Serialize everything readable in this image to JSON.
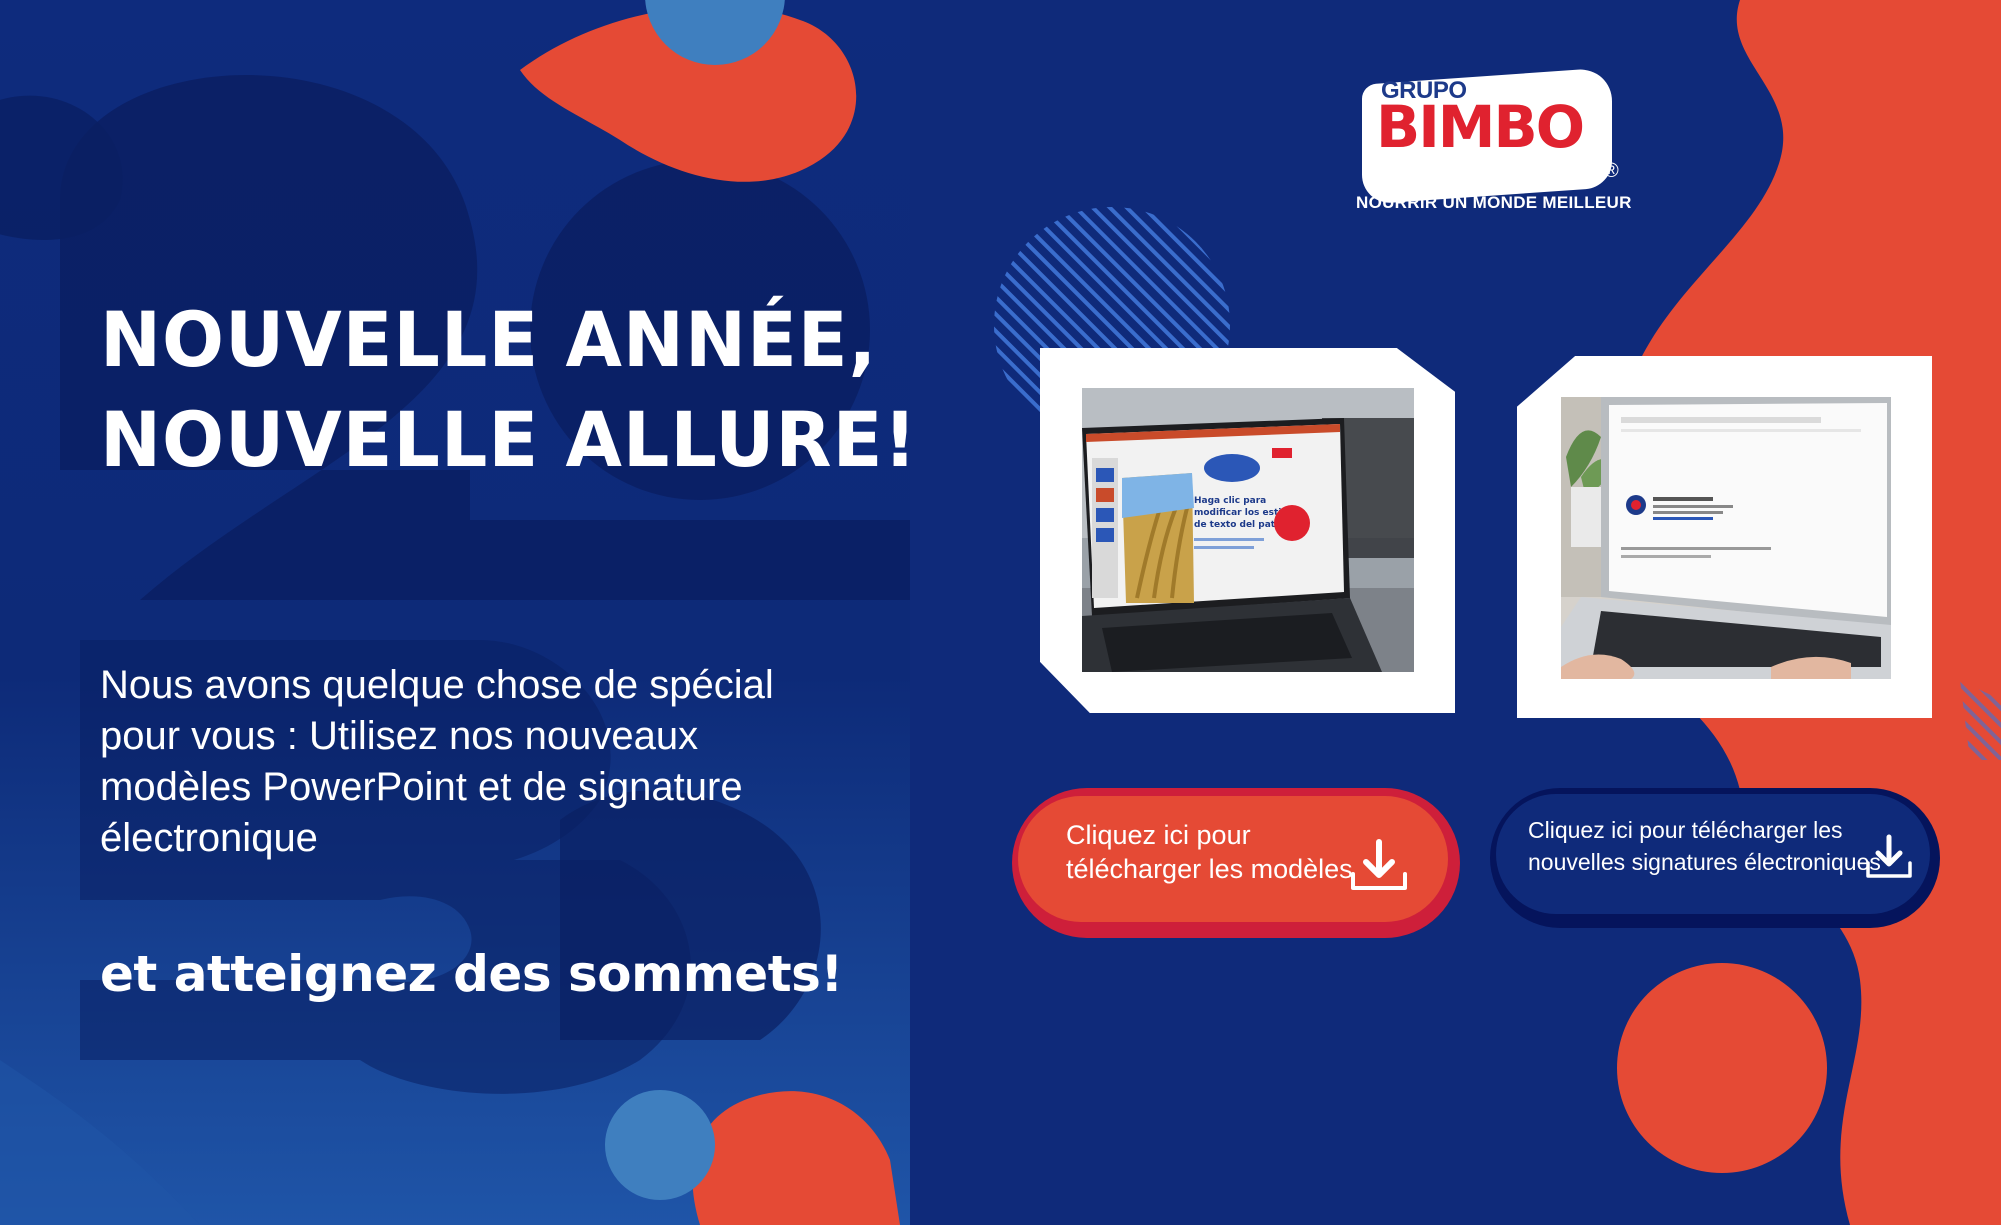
{
  "headline": {
    "line1": "NOUVELLE ANNÉE,",
    "line2": "NOUVELLE ALLURE!"
  },
  "body": {
    "text": "Nous avons quelque chose de spécial pour vous : Utilisez nos nouveaux modèles PowerPoint et de signature électronique"
  },
  "tagline": "et atteignez des sommets!",
  "logo": {
    "grupo": "GRUPO",
    "brand": "BIMBO",
    "registered": "®",
    "slogan": "NOURRIR UN MONDE MEILLEUR"
  },
  "ppt_slide": {
    "title": "Haga clic para modificar los estilos de texto del patrón"
  },
  "cta": {
    "models_label": "Cliquez ici pour télécharger les modèles",
    "signatures_label": "Cliquez ici pour télécharger les nouvelles signatures électroniques"
  },
  "icons": {
    "download": "download-icon"
  },
  "colors": {
    "navy": "#0f2a7a",
    "deep_navy": "#08195c",
    "coral": "#e54a35",
    "sky_blue": "#3f7fbf",
    "crimson": "#ce1f3a",
    "white": "#ffffff"
  }
}
